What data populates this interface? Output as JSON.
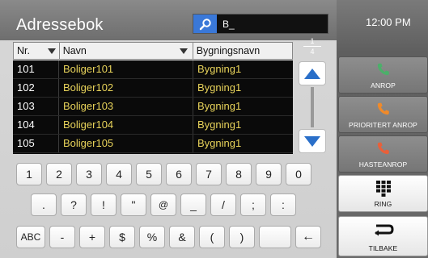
{
  "header": {
    "title": "Adressebok",
    "search_value": "B_",
    "clock": "12:00 PM"
  },
  "table": {
    "columns": [
      "Nr.",
      "Navn",
      "Bygningsnavn"
    ],
    "rows": [
      {
        "nr": "101",
        "navn": "Boliger101",
        "bygg": "Bygning1"
      },
      {
        "nr": "102",
        "navn": "Boliger102",
        "bygg": "Bygning1"
      },
      {
        "nr": "103",
        "navn": "Boliger103",
        "bygg": "Bygning1"
      },
      {
        "nr": "104",
        "navn": "Boliger104",
        "bygg": "Bygning1"
      },
      {
        "nr": "105",
        "navn": "Boliger105",
        "bygg": "Bygning1"
      }
    ]
  },
  "paging": {
    "current": "1",
    "total": "4"
  },
  "keyboard": {
    "row1": [
      "1",
      "2",
      "3",
      "4",
      "5",
      "6",
      "7",
      "8",
      "9",
      "0"
    ],
    "row2": [
      ".",
      "?",
      "!",
      "\"",
      "@",
      "_",
      "/",
      ";",
      ":"
    ],
    "row3": [
      "ABC",
      "-",
      "+",
      "$",
      "%",
      "&",
      "(",
      ")",
      " ",
      "←"
    ]
  },
  "actions": {
    "anrop": "ANROP",
    "prioritert": "PRIORITERT ANROP",
    "hasteanrop": "HASTEANROP",
    "ring": "RING",
    "tilbake": "TILBAKE"
  },
  "colors": {
    "accent": "#2a6fc9",
    "name_text": "#e8d35a",
    "anrop_icon": "#4caf6a",
    "prioritert_icon": "#f08a2a",
    "haste_icon": "#e8603a"
  }
}
